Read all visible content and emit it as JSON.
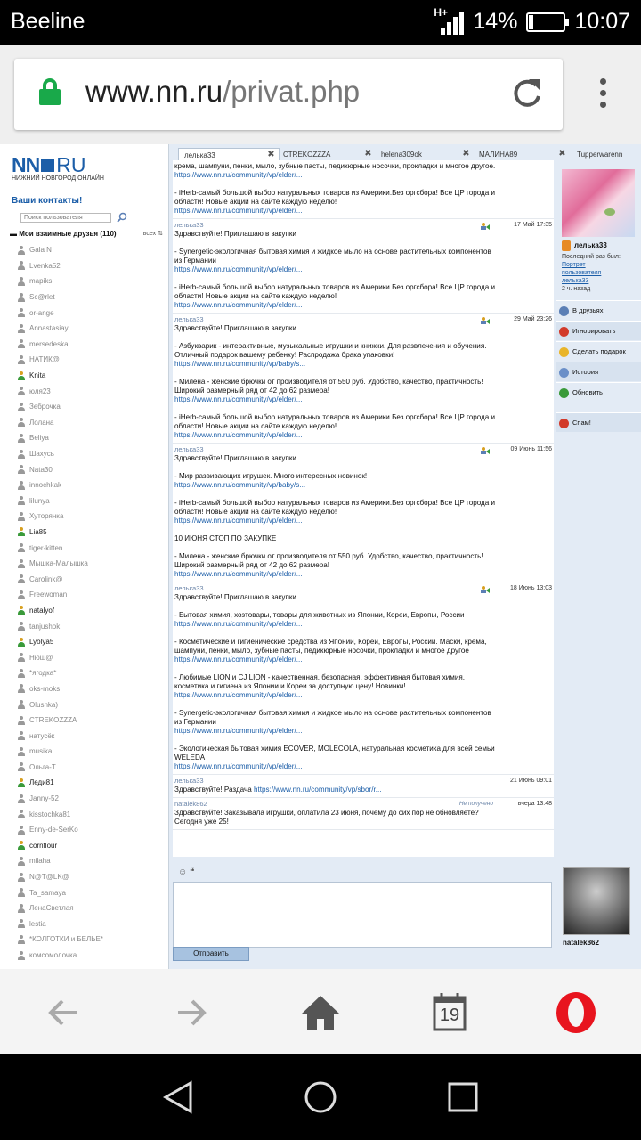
{
  "statusbar": {
    "carrier": "Beeline",
    "net": "H+",
    "battery": "14%",
    "time": "10:07"
  },
  "browser": {
    "url_host": "www.nn.ru",
    "url_path": "/privat.php"
  },
  "left": {
    "logo_nn": "NN",
    "logo_ru": "RU",
    "logo_sub": "НИЖНИЙ НОВГОРОД ОНЛАЙН",
    "contacts_title": "Ваши контакты!",
    "search_placeholder": "Поиск пользователя",
    "friends_title": "Мои взаимные друзья (110)",
    "friends_all": "всех ⇅",
    "friends": [
      {
        "name": "Gala N",
        "on": false
      },
      {
        "name": "Lvenka52",
        "on": false
      },
      {
        "name": "mapiks",
        "on": false
      },
      {
        "name": "Sc@rlet",
        "on": false
      },
      {
        "name": "or-ange",
        "on": false
      },
      {
        "name": "Annastasiay",
        "on": false
      },
      {
        "name": "mersedeska",
        "on": false
      },
      {
        "name": "НАТИК@",
        "on": false
      },
      {
        "name": "Knita",
        "on": true
      },
      {
        "name": "юля23",
        "on": false
      },
      {
        "name": "Зеброчка",
        "on": false
      },
      {
        "name": "Лолана",
        "on": false
      },
      {
        "name": "Beliya",
        "on": false
      },
      {
        "name": "Шахусь",
        "on": false
      },
      {
        "name": "Nata30",
        "on": false
      },
      {
        "name": "innochkak",
        "on": false
      },
      {
        "name": "lilunya",
        "on": false
      },
      {
        "name": "Хуторянка",
        "on": false
      },
      {
        "name": "Lia85",
        "on": true
      },
      {
        "name": "tiger-kitten",
        "on": false
      },
      {
        "name": "Мышка-Малышка",
        "on": false
      },
      {
        "name": "Carolink@",
        "on": false
      },
      {
        "name": "Freewoman",
        "on": false
      },
      {
        "name": "natalyof",
        "on": true
      },
      {
        "name": "tanjushok",
        "on": false
      },
      {
        "name": "Lyolya5",
        "on": true
      },
      {
        "name": "Нюш@",
        "on": false
      },
      {
        "name": "*ягодка*",
        "on": false
      },
      {
        "name": "oks-moks",
        "on": false
      },
      {
        "name": "Olushka)",
        "on": false
      },
      {
        "name": "CTREKOZZZA",
        "on": false
      },
      {
        "name": "натусёк",
        "on": false
      },
      {
        "name": "musika",
        "on": false
      },
      {
        "name": "Ольга-Т",
        "on": false
      },
      {
        "name": "Леди81",
        "on": true
      },
      {
        "name": "Janny-52",
        "on": false
      },
      {
        "name": "kisstochka81",
        "on": false
      },
      {
        "name": "Enny-de-SerKo",
        "on": false
      },
      {
        "name": "cornflour",
        "on": true
      },
      {
        "name": "milaha",
        "on": false
      },
      {
        "name": "N@T@LK@",
        "on": false
      },
      {
        "name": "Ta_samaya",
        "on": false
      },
      {
        "name": "ЛенаСветлая",
        "on": false
      },
      {
        "name": "lestia",
        "on": false
      },
      {
        "name": "*КОЛГОТКИ и БЕЛЬЕ*",
        "on": false
      },
      {
        "name": "комсомолочка",
        "on": false
      }
    ]
  },
  "tabs": [
    "лелька33",
    "CTREKOZZZA",
    "helena309ok",
    "МАЛИНА89",
    "Tupperwarenn"
  ],
  "messages": [
    {
      "author": "",
      "date": "",
      "fav": false,
      "status": "",
      "text": "крема, шампуни, пенки, мыло, зубные пасты, педикюрные носочки, прокладки и многое другое.\nhttps://www.nn.ru/community/vp/elder/...\n\n- iHerb-самый большой выбор натуральных товаров из Америки.Без оргсбора! Все ЦР города и области! Новые акции на сайте каждую неделю!\nhttps://www.nn.ru/community/vp/elder/..."
    },
    {
      "author": "лелька33",
      "date": "17 Май 17:35",
      "fav": true,
      "status": "",
      "text": "Здравствуйте! Приглашаю в закупки\n\n- Synergetic-экологичная бытовая химия и жидкое мыло на основе растительных компонентов из Германии\nhttps://www.nn.ru/community/vp/elder/...\n\n- iHerb-самый большой выбор натуральных товаров из Америки.Без оргсбора! Все ЦР города и области! Новые акции на сайте каждую неделю!\nhttps://www.nn.ru/community/vp/elder/..."
    },
    {
      "author": "лелька33",
      "date": "29 Май 23:26",
      "fav": true,
      "status": "",
      "text": "Здравствуйте! Приглашаю в закупки\n\n- Азбукварик - интерактивные, музыкальные игрушки и книжки. Для развлечения и обучения. Отличный подарок вашему ребенку! Распродажа брака упаковки!\nhttps://www.nn.ru/community/vp/baby/s...\n\n- Милена - женские брючки от производителя от 550 руб. Удобство, качество, практичность! Широкий размерный ряд от 42 до 62 размера!\nhttps://www.nn.ru/community/vp/elder/...\n\n- iHerb-самый большой выбор натуральных товаров из Америки.Без оргсбора! Все ЦР города и области! Новые акции на сайте каждую неделю!\nhttps://www.nn.ru/community/vp/elder/..."
    },
    {
      "author": "лелька33",
      "date": "09 Июнь 11:56",
      "fav": true,
      "status": "",
      "text": "Здравствуйте! Приглашаю в закупки\n\n- Мир развивающих игрушек. Много интересных новинок!\nhttps://www.nn.ru/community/vp/baby/s...\n\n- iHerb-самый большой выбор натуральных товаров из Америки.Без оргсбора! Все ЦР города и области! Новые акции на сайте каждую неделю!\nhttps://www.nn.ru/community/vp/elder/...\n\n10 ИЮНЯ СТОП ПО ЗАКУПКЕ\n\n- Милена - женские брючки от производителя от 550 руб. Удобство, качество, практичность! Широкий размерный ряд от 42 до 62 размера!\nhttps://www.nn.ru/community/vp/elder/..."
    },
    {
      "author": "лелька33",
      "date": "18 Июнь 13:03",
      "fav": true,
      "status": "",
      "text": "Здравствуйте! Приглашаю в закупки\n\n- Бытовая химия, хозтовары, товары для животных из Японии, Кореи, Европы, России\nhttps://www.nn.ru/community/vp/elder/...\n\n- Косметические и гигиенические средства из Японии, Кореи, Европы, России. Маски, крема, шампуни, пенки, мыло, зубные пасты, педикюрные носочки, прокладки и многое другое\nhttps://www.nn.ru/community/vp/elder/...\n\n- Любимые LION и CJ LION - качественная, безопасная, эффективная бытовая химия, косметика и гигиена из Японии и Кореи за доступную цену! Новинки!\nhttps://www.nn.ru/community/vp/elder/...\n\n- Synergetic-экологичная бытовая химия и жидкое мыло на основе растительных компонентов из Германии\nhttps://www.nn.ru/community/vp/elder/...\n\n- Экологическая бытовая химия ECOVER, MOLECOLA, натуральная косметика для всей семьи WELEDA\nhttps://www.nn.ru/community/vp/elder/..."
    },
    {
      "author": "лелька33",
      "date": "21 Июнь 09:01",
      "fav": false,
      "status": "",
      "text": "Здравствуйте! Раздача https://www.nn.ru/community/vp/sbor/r..."
    },
    {
      "author": "natalek862",
      "date": "вчера 13:48",
      "fav": false,
      "status": "Не получено",
      "text": "Здравствуйте! Заказывала игрушки, оплатила 23 июня, почему до сих пор не обновляете? Сегодня уже 25!"
    }
  ],
  "side": {
    "uname": "лелька33",
    "last_label": "Последний раз был:",
    "last_link1": "Портрет",
    "last_link2": "пользователя",
    "last_link3": "лелька33",
    "last_ago": "2 ч. назад",
    "actions": [
      {
        "label": "В друзьях",
        "color": "#5b7fb5"
      },
      {
        "label": "Игнорировать",
        "color": "#d23a2a"
      },
      {
        "label": "Сделать подарок",
        "color": "#e9b52a"
      },
      {
        "label": "История",
        "color": "#6a8fc8"
      },
      {
        "label": "Обновить",
        "color": "#3a9a3a"
      },
      {
        "label": "Спам!",
        "color": "#d23a2a"
      }
    ]
  },
  "composer": {
    "tools": "☺ ❝",
    "send": "Отправить",
    "me": "natalek862"
  },
  "navbar": {
    "tabs_count": "19"
  }
}
